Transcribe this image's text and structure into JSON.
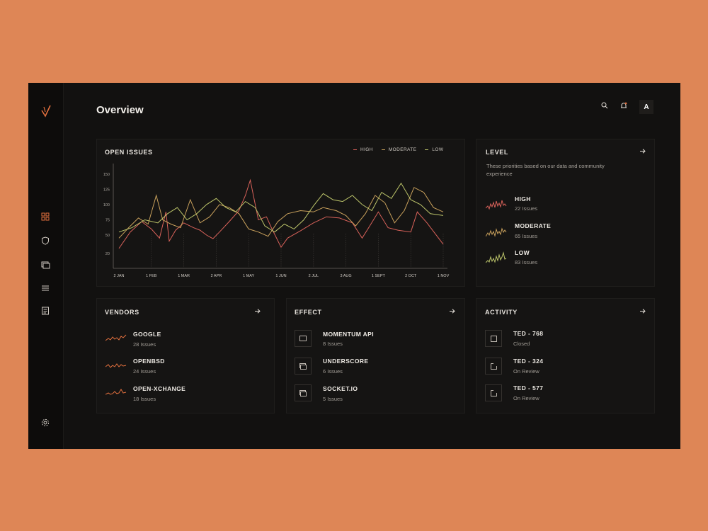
{
  "page": {
    "title": "Overview",
    "avatar_initial": "A"
  },
  "sidebar": {
    "logo": "logo-icon",
    "items": [
      {
        "icon": "grid-icon"
      },
      {
        "icon": "shield-icon"
      },
      {
        "icon": "cards-icon"
      },
      {
        "icon": "list-icon"
      },
      {
        "icon": "document-icon"
      }
    ],
    "footer_icon": "settings-icon"
  },
  "header": {
    "icons": [
      "search-icon",
      "bell-icon"
    ]
  },
  "colors": {
    "background": "#DE8656",
    "panel": "#121110",
    "high": "#D9625A",
    "moderate": "#C9A15C",
    "low": "#BCC46A",
    "accent": "#E2703E"
  },
  "open_issues": {
    "title": "OPEN ISSUES",
    "legend": [
      {
        "label": "HIGH",
        "color": "#D9625A"
      },
      {
        "label": "MODERATE",
        "color": "#C9A15C"
      },
      {
        "label": "LOW",
        "color": "#BCC46A"
      }
    ]
  },
  "chart_data": {
    "type": "line",
    "title": "OPEN ISSUES",
    "x_labels": [
      "2 JAN",
      "1 FEB",
      "1 MAR",
      "2 APR",
      "1 MAY",
      "1 JUN",
      "2 JUL",
      "3 AUG",
      "1 SEPT",
      "2 OCT",
      "1 NOV"
    ],
    "y_ticks": [
      20,
      50,
      75,
      100,
      125,
      150
    ],
    "ylim": [
      0,
      165
    ],
    "grid": false,
    "legend_position": "top-right",
    "series": [
      {
        "name": "HIGH",
        "color": "#D9625A",
        "points": [
          [
            0,
            28
          ],
          [
            0.35,
            55
          ],
          [
            0.7,
            72
          ],
          [
            1.0,
            60
          ],
          [
            1.25,
            45
          ],
          [
            1.45,
            88
          ],
          [
            1.55,
            40
          ],
          [
            1.75,
            58
          ],
          [
            2.0,
            70
          ],
          [
            2.3,
            62
          ],
          [
            2.5,
            58
          ],
          [
            2.7,
            50
          ],
          [
            2.9,
            44
          ],
          [
            3.1,
            55
          ],
          [
            3.4,
            72
          ],
          [
            3.7,
            90
          ],
          [
            3.9,
            115
          ],
          [
            4.05,
            140
          ],
          [
            4.3,
            75
          ],
          [
            4.55,
            80
          ],
          [
            4.7,
            62
          ],
          [
            5.0,
            30
          ],
          [
            5.2,
            45
          ],
          [
            5.6,
            57
          ],
          [
            6.0,
            70
          ],
          [
            6.4,
            80
          ],
          [
            6.8,
            78
          ],
          [
            7.2,
            70
          ],
          [
            7.5,
            45
          ],
          [
            7.7,
            62
          ],
          [
            8.0,
            88
          ],
          [
            8.3,
            62
          ],
          [
            8.6,
            58
          ],
          [
            9.0,
            55
          ],
          [
            9.2,
            88
          ],
          [
            9.5,
            70
          ],
          [
            10.0,
            35
          ]
        ]
      },
      {
        "name": "MODERATE",
        "color": "#C9A15C",
        "points": [
          [
            0,
            45
          ],
          [
            0.3,
            62
          ],
          [
            0.6,
            78
          ],
          [
            0.9,
            68
          ],
          [
            1.15,
            115
          ],
          [
            1.35,
            75
          ],
          [
            1.6,
            68
          ],
          [
            1.9,
            62
          ],
          [
            2.2,
            108
          ],
          [
            2.5,
            70
          ],
          [
            2.8,
            80
          ],
          [
            3.1,
            100
          ],
          [
            3.4,
            95
          ],
          [
            3.7,
            85
          ],
          [
            4.0,
            60
          ],
          [
            4.3,
            55
          ],
          [
            4.6,
            48
          ],
          [
            4.9,
            72
          ],
          [
            5.2,
            85
          ],
          [
            5.6,
            90
          ],
          [
            6.0,
            88
          ],
          [
            6.3,
            95
          ],
          [
            6.7,
            90
          ],
          [
            7.0,
            82
          ],
          [
            7.3,
            65
          ],
          [
            7.6,
            85
          ],
          [
            7.9,
            115
          ],
          [
            8.2,
            103
          ],
          [
            8.5,
            70
          ],
          [
            8.8,
            90
          ],
          [
            9.1,
            128
          ],
          [
            9.4,
            120
          ],
          [
            9.7,
            95
          ],
          [
            10.0,
            88
          ]
        ]
      },
      {
        "name": "LOW",
        "color": "#BCC46A",
        "points": [
          [
            0,
            55
          ],
          [
            0.4,
            62
          ],
          [
            0.8,
            75
          ],
          [
            1.2,
            70
          ],
          [
            1.5,
            85
          ],
          [
            1.8,
            95
          ],
          [
            2.1,
            75
          ],
          [
            2.4,
            85
          ],
          [
            2.7,
            100
          ],
          [
            3.0,
            110
          ],
          [
            3.3,
            95
          ],
          [
            3.6,
            88
          ],
          [
            3.9,
            105
          ],
          [
            4.2,
            95
          ],
          [
            4.5,
            65
          ],
          [
            4.8,
            55
          ],
          [
            5.1,
            68
          ],
          [
            5.4,
            60
          ],
          [
            5.7,
            75
          ],
          [
            6.0,
            98
          ],
          [
            6.3,
            118
          ],
          [
            6.6,
            108
          ],
          [
            6.9,
            105
          ],
          [
            7.2,
            115
          ],
          [
            7.5,
            100
          ],
          [
            7.8,
            90
          ],
          [
            8.1,
            120
          ],
          [
            8.4,
            110
          ],
          [
            8.7,
            135
          ],
          [
            9.0,
            108
          ],
          [
            9.3,
            100
          ],
          [
            9.6,
            85
          ],
          [
            10.0,
            82
          ]
        ]
      }
    ]
  },
  "level": {
    "title": "LEVEL",
    "description": "These priorities based on our data and community experience",
    "items": [
      {
        "name": "HIGH",
        "sub": "22 Issues",
        "color": "#D9625A"
      },
      {
        "name": "MODERATE",
        "sub": "65 Issues",
        "color": "#C9A15C"
      },
      {
        "name": "LOW",
        "sub": "83 Issues",
        "color": "#BCC46A"
      }
    ]
  },
  "vendors": {
    "title": "VENDORS",
    "items": [
      {
        "name": "GOOGLE",
        "sub": "28 Issues"
      },
      {
        "name": "OPENBSD",
        "sub": "24 Issues"
      },
      {
        "name": "OPEN-XCHANGE",
        "sub": "18 Issues"
      }
    ]
  },
  "effect": {
    "title": "EFFECT",
    "items": [
      {
        "name": "MOMENTUM API",
        "sub": "8 Issues",
        "icon": "window-icon"
      },
      {
        "name": "UNDERSCORE",
        "sub": "6 Issues",
        "icon": "stack-icon"
      },
      {
        "name": "SOCKET.IO",
        "sub": "5 Issues",
        "icon": "stack-icon"
      }
    ]
  },
  "activity": {
    "title": "ACTIVITY",
    "items": [
      {
        "name": "TED - 768",
        "sub": "Closed",
        "icon": "square-icon"
      },
      {
        "name": "TED - 324",
        "sub": "On Review",
        "icon": "corner-icon"
      },
      {
        "name": "TED - 577",
        "sub": "On Review",
        "icon": "corner-icon"
      }
    ]
  }
}
